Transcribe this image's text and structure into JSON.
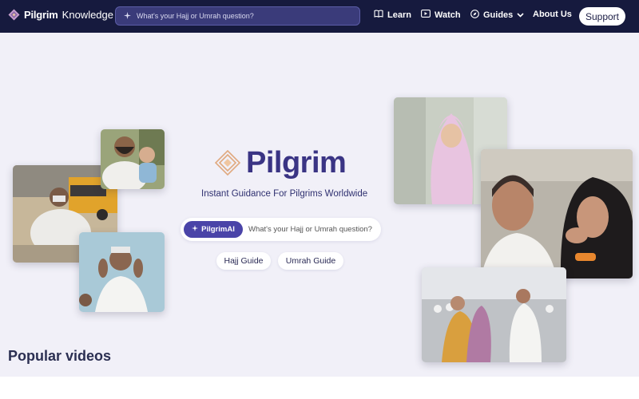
{
  "nav": {
    "brand_name": "Pilgrim",
    "brand_sub": "Knowledge",
    "search_placeholder": "What's your Hajj or Umrah question?",
    "items": [
      {
        "label": "Learn",
        "icon": "book-icon"
      },
      {
        "label": "Watch",
        "icon": "play-icon"
      },
      {
        "label": "Guides",
        "icon": "compass-icon"
      },
      {
        "label": "About Us"
      }
    ],
    "support_label": "Support"
  },
  "hero": {
    "title": "Pilgrim",
    "tagline": "Instant Guidance For Pilgrims Worldwide",
    "ai_chip_label": "PilgrimAI",
    "ai_placeholder": "What's your Hajj or Umrah question?",
    "guides": [
      "Hajj Guide",
      "Umrah Guide"
    ]
  },
  "sections": {
    "popular_videos": "Popular videos"
  },
  "colors": {
    "nav_bg": "#161a3e",
    "accent": "#4a44a8",
    "title": "#3a3484",
    "page_bg": "#f1f0f8"
  }
}
